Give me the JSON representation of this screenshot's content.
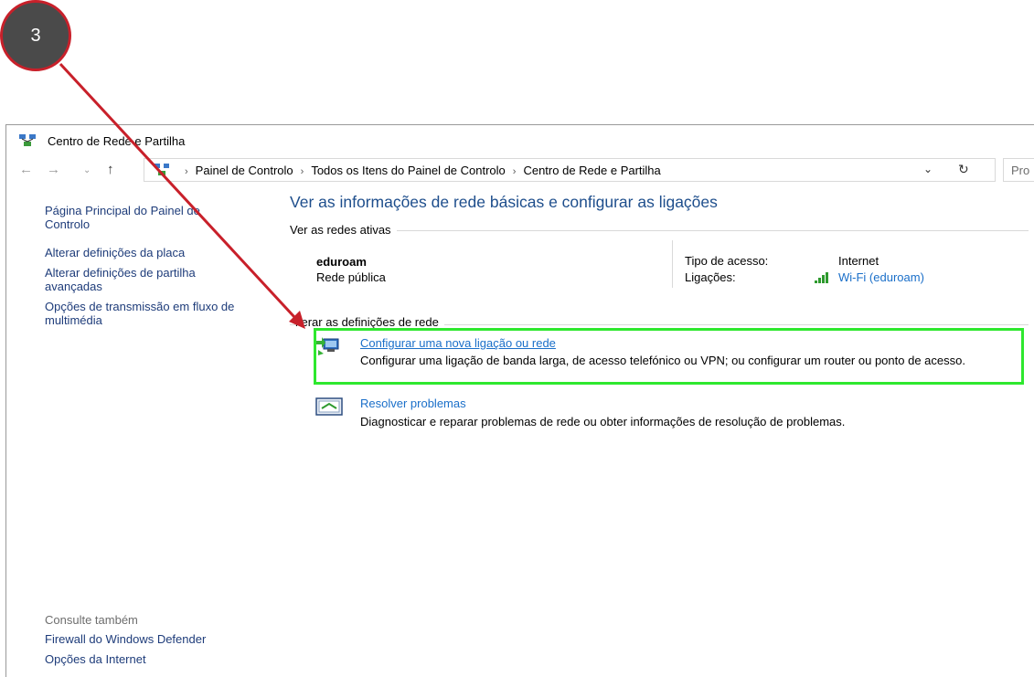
{
  "step_number": "3",
  "window": {
    "title": "Centro de Rede e Partilha"
  },
  "address_bar": {
    "breadcrumbs": [
      "Painel de Controlo",
      "Todos os Itens do Painel de Controlo",
      "Centro de Rede e Partilha"
    ],
    "search_placeholder": "Pro"
  },
  "left_pane": {
    "links": [
      "Página Principal do Painel de Controlo",
      "Alterar definições da placa",
      "Alterar definições de partilha avançadas",
      "Opções de transmissão em fluxo de multimédia"
    ],
    "see_also_heading": "Consulte também",
    "see_also_links": [
      "Firewall do Windows Defender",
      "Opções da Internet"
    ]
  },
  "main": {
    "title": "Ver as informações de rede básicas e configurar as ligações",
    "active_networks_label": "Ver as redes ativas",
    "network": {
      "name": "eduroam",
      "type": "Rede pública",
      "access_type_label": "Tipo de acesso:",
      "access_type_value": "Internet",
      "connections_label": "Ligações:",
      "connections_value": "Wi-Fi (eduroam)"
    },
    "change_settings_label": "lterar as definições de rede",
    "tasks": [
      {
        "link": "Configurar uma nova ligação ou rede",
        "description": "Configurar uma ligação de banda larga, de acesso telefónico ou VPN; ou configurar um router ou ponto de acesso.",
        "icon": "network-setup-icon"
      },
      {
        "link": "Resolver problemas",
        "description": "Diagnosticar e reparar problemas de rede ou obter informações de resolução de problemas.",
        "icon": "troubleshoot-icon"
      }
    ]
  },
  "colors": {
    "highlight": "#2ee82e",
    "arrow": "#c8202a",
    "link": "#1a6fc9",
    "title": "#1e4e8c"
  }
}
